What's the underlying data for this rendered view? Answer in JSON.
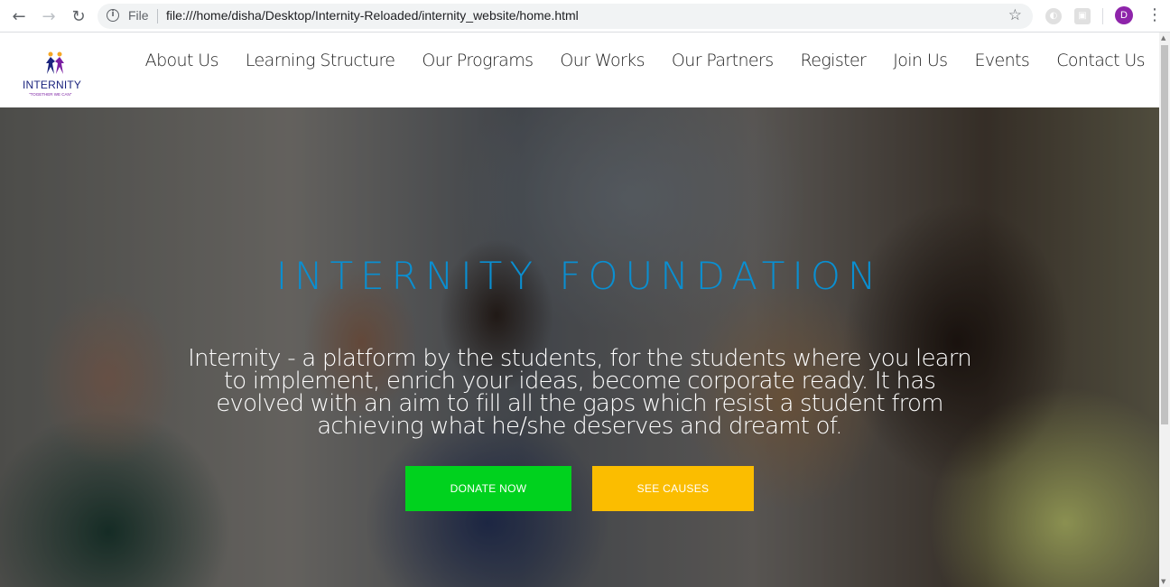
{
  "browser": {
    "back_icon": "arrow-left-icon",
    "forward_icon": "arrow-right-icon",
    "reload_icon": "reload-icon",
    "info_label": "File",
    "url": "file:///home/disha/Desktop/Internity-Reloaded/internity_website/home.html",
    "profile_initial": "D",
    "profile_color": "#8e24aa"
  },
  "header": {
    "logo_text": "INTERNITY",
    "logo_tagline": "\"TOGETHER WE CAN\"",
    "menu": [
      {
        "label": "About Us"
      },
      {
        "label": "Learning Structure"
      },
      {
        "label": "Our Programs"
      },
      {
        "label": "Our Works"
      },
      {
        "label": "Our Partners"
      },
      {
        "label": "Register"
      },
      {
        "label": "Join Us"
      },
      {
        "label": "Events"
      },
      {
        "label": "Contact Us"
      }
    ]
  },
  "hero": {
    "title": "INTERNITY FOUNDATION",
    "subtitle": "Internity - a platform by the students, for the students where you learn to implement, enrich your ideas, become corporate ready. It has evolved with an aim to fill all the gaps which resist a student from achieving what he/she deserves and dreamt of.",
    "title_color": "#0a8fd1",
    "donate_label": "DONATE NOW",
    "donate_color": "#00d21e",
    "causes_label": "SEE CAUSES",
    "causes_color": "#fbbd00"
  }
}
